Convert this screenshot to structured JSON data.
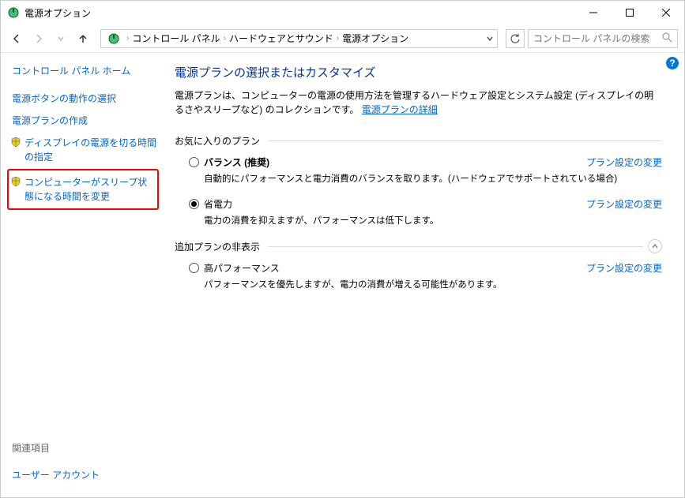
{
  "window": {
    "title": "電源オプション"
  },
  "breadcrumb": {
    "items": [
      "コントロール パネル",
      "ハードウェアとサウンド",
      "電源オプション"
    ]
  },
  "search": {
    "placeholder": "コントロール パネルの検索"
  },
  "sidebar": {
    "home": "コントロール パネル ホーム",
    "links": [
      "電源ボタンの動作の選択",
      "電源プランの作成",
      "ディスプレイの電源を切る時間の指定",
      "コンピューターがスリープ状態になる時間を変更"
    ],
    "related_title": "関連項目",
    "related_link": "ユーザー アカウント"
  },
  "main": {
    "heading": "電源プランの選択またはカスタマイズ",
    "description_pre": "電源プランは、コンピューターの電源の使用方法を管理するハードウェア設定とシステム設定 (ディスプレイの明るさやスリープなど) のコレクションです。",
    "description_link": "電源プランの詳細",
    "favorite_title": "お気に入りのプラン",
    "additional_title": "追加プランの非表示",
    "edit_label": "プラン設定の変更",
    "plans": [
      {
        "name": "バランス (推奨)",
        "desc": "自動的にパフォーマンスと電力消費のバランスを取ります。(ハードウェアでサポートされている場合)",
        "checked": false,
        "bold": true
      },
      {
        "name": "省電力",
        "desc": "電力の消費を抑えますが、パフォーマンスは低下します。",
        "checked": true,
        "bold": false
      }
    ],
    "additional_plans": [
      {
        "name": "高パフォーマンス",
        "desc": "パフォーマンスを優先しますが、電力の消費が増える可能性があります。",
        "checked": false,
        "bold": false
      }
    ]
  }
}
